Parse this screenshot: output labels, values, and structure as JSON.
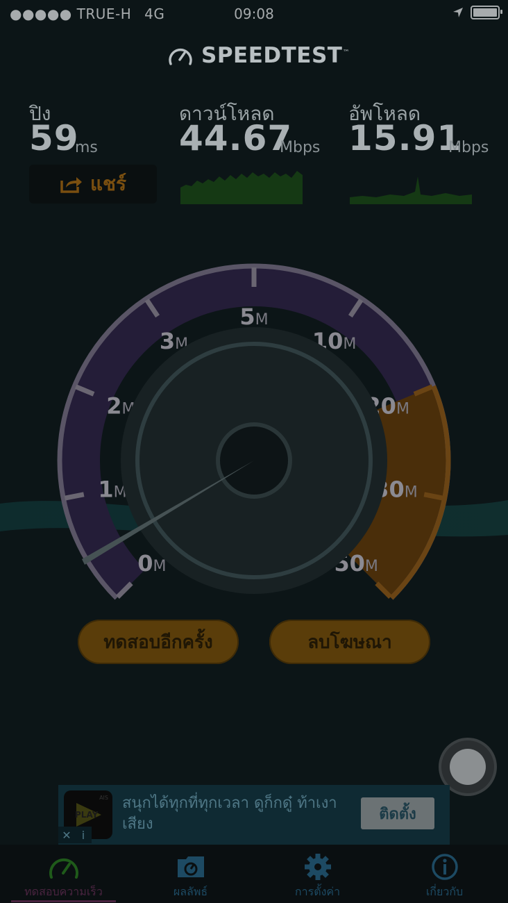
{
  "status": {
    "carrier": "●●●●● TRUE-H",
    "network": "4G",
    "time": "09:08"
  },
  "header": {
    "title": "SPEEDTEST",
    "trademark": "™"
  },
  "metrics": {
    "ping": {
      "label": "ปิง",
      "value": "59",
      "unit": "ms"
    },
    "download": {
      "label": "ดาวน์โหลด",
      "value": "44.67",
      "unit": "Mbps"
    },
    "upload": {
      "label": "อัพโหลด",
      "value": "15.91",
      "unit": "Mbps"
    }
  },
  "share": {
    "label": "แชร์"
  },
  "gauge": {
    "ticks": [
      {
        "num": "0",
        "unit": "M"
      },
      {
        "num": "1",
        "unit": "M"
      },
      {
        "num": "2",
        "unit": "M"
      },
      {
        "num": "3",
        "unit": "M"
      },
      {
        "num": "5",
        "unit": "M"
      },
      {
        "num": "10",
        "unit": "M"
      },
      {
        "num": "20",
        "unit": "M"
      },
      {
        "num": "30",
        "unit": "M"
      },
      {
        "num": "50",
        "unit": "M"
      }
    ]
  },
  "buttons": {
    "retest": "ทดสอบอีกครั้ง",
    "remove_ads": "ลบโฆษณา"
  },
  "ad": {
    "text": "สนุกได้ทุกที่ทุกเวลา ดูก็กดู๋ ท้าเงาเสียง",
    "install": "ติดตั้ง",
    "logo_text": "PLAY",
    "logo_brand": "AIS",
    "close": "✕",
    "info": "i"
  },
  "tabs": [
    {
      "label": "ทดสอบความเร็ว",
      "icon": "speedometer-icon"
    },
    {
      "label": "ผลลัพธ์",
      "icon": "results-icon"
    },
    {
      "label": "การตั้งค่า",
      "icon": "gear-icon"
    },
    {
      "label": "เกี่ยวกับ",
      "icon": "info-icon"
    }
  ],
  "colors": {
    "accent": "#c47a12",
    "gauge_arc": "#3a2d55",
    "green": "#1f5a1a",
    "tab_blue": "#1d4a63"
  }
}
